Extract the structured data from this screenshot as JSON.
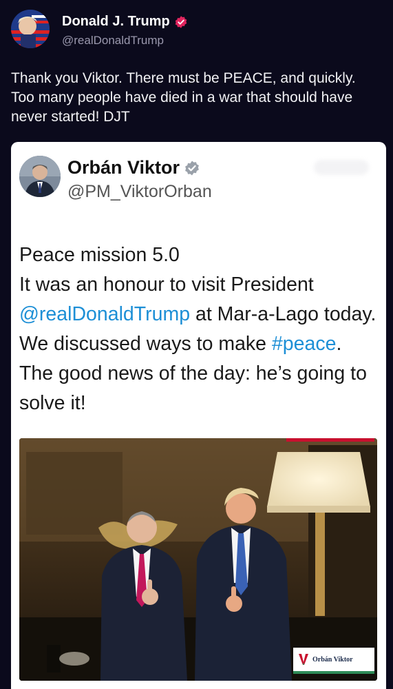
{
  "outer_post": {
    "author_name": "Donald J. Trump",
    "author_handle": "@realDonaldTrump",
    "text": "Thank you Viktor. There must be PEACE, and quickly. Too many people have died in a war that should have never started! DJT"
  },
  "quoted_post": {
    "author_name": "Orbán Viktor",
    "author_handle": "@PM_ViktorOrban",
    "line1": "Peace mission 5.0",
    "line2_prefix": "It was an honour to visit President ",
    "mention": "@realDonaldTrump",
    "line2_suffix": " at Mar-a-Lago today. We discussed ways to make ",
    "hashtag": "#peace",
    "line2_end": ". The good news of the day: he’s going to solve it!",
    "photo_badge": "Orbán Viktor"
  },
  "colors": {
    "background": "#0b0a1c",
    "verified_pink": "#e0245e",
    "verified_blue": "#1d9bf0",
    "link_blue": "#1d8fd6"
  },
  "icons": {
    "outer_verified": "verified-badge-icon",
    "quoted_verified": "verified-badge-icon"
  }
}
